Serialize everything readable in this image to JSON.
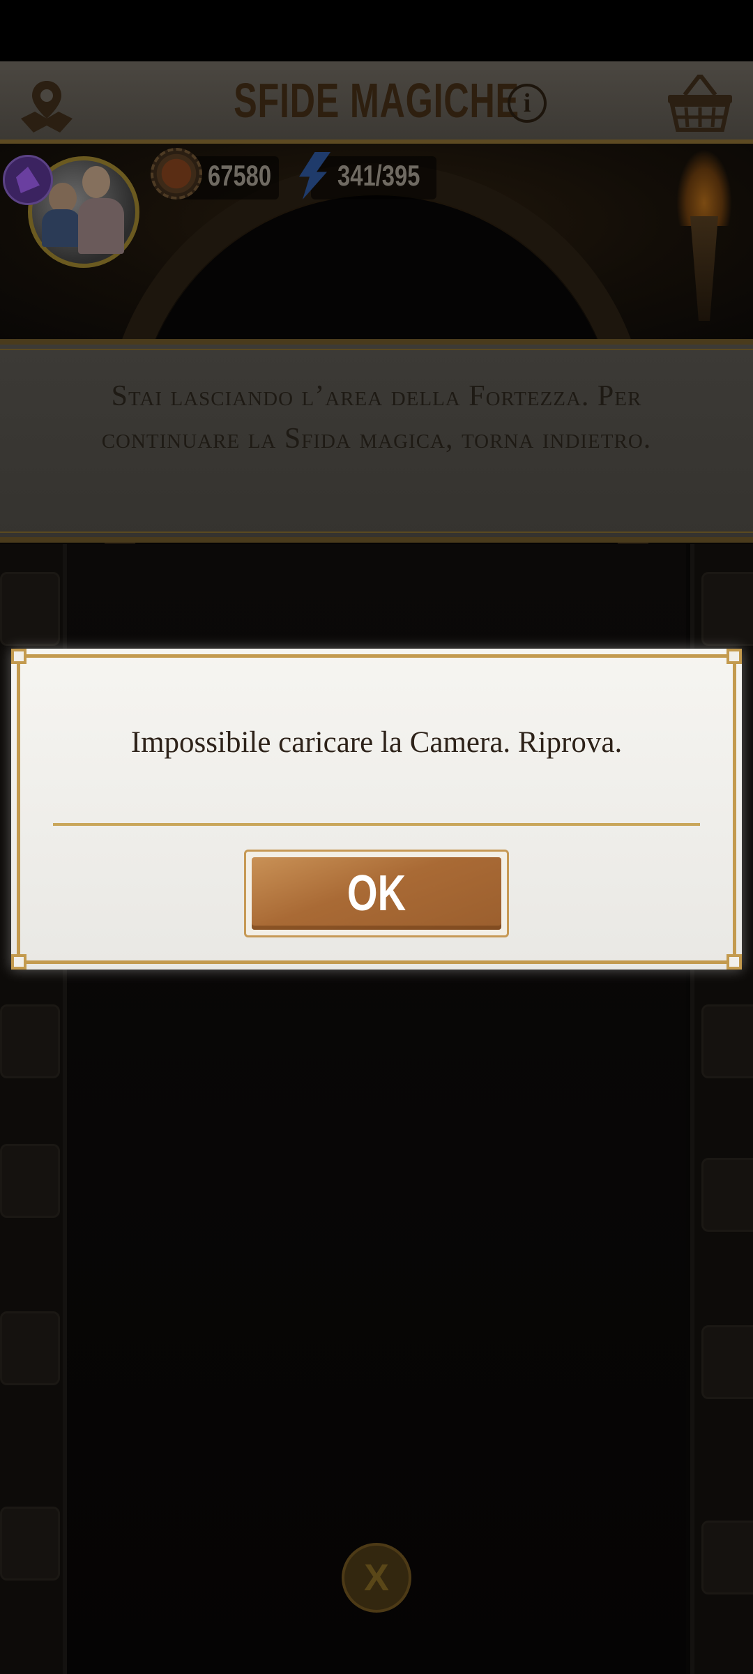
{
  "header": {
    "title": "SFIDE MAGICHE",
    "map_icon": "map-pin-icon",
    "info_icon": "info-icon",
    "info_glyph": "i",
    "basket_icon": "basket-icon"
  },
  "stats": {
    "coins": "67580",
    "energy": "341/395"
  },
  "notice": {
    "text": "Stai lasciando l’area della Fortezza. Per continuare la Sfida magica, torna indietro."
  },
  "dialog": {
    "message": "Impossibile caricare la Camera. Riprova.",
    "ok_label": "OK"
  },
  "footer": {
    "close_label": "X"
  },
  "colors": {
    "accent_gold": "#c39a4e",
    "button_brown": "#a96a35",
    "header_text": "#2e1f0f"
  }
}
